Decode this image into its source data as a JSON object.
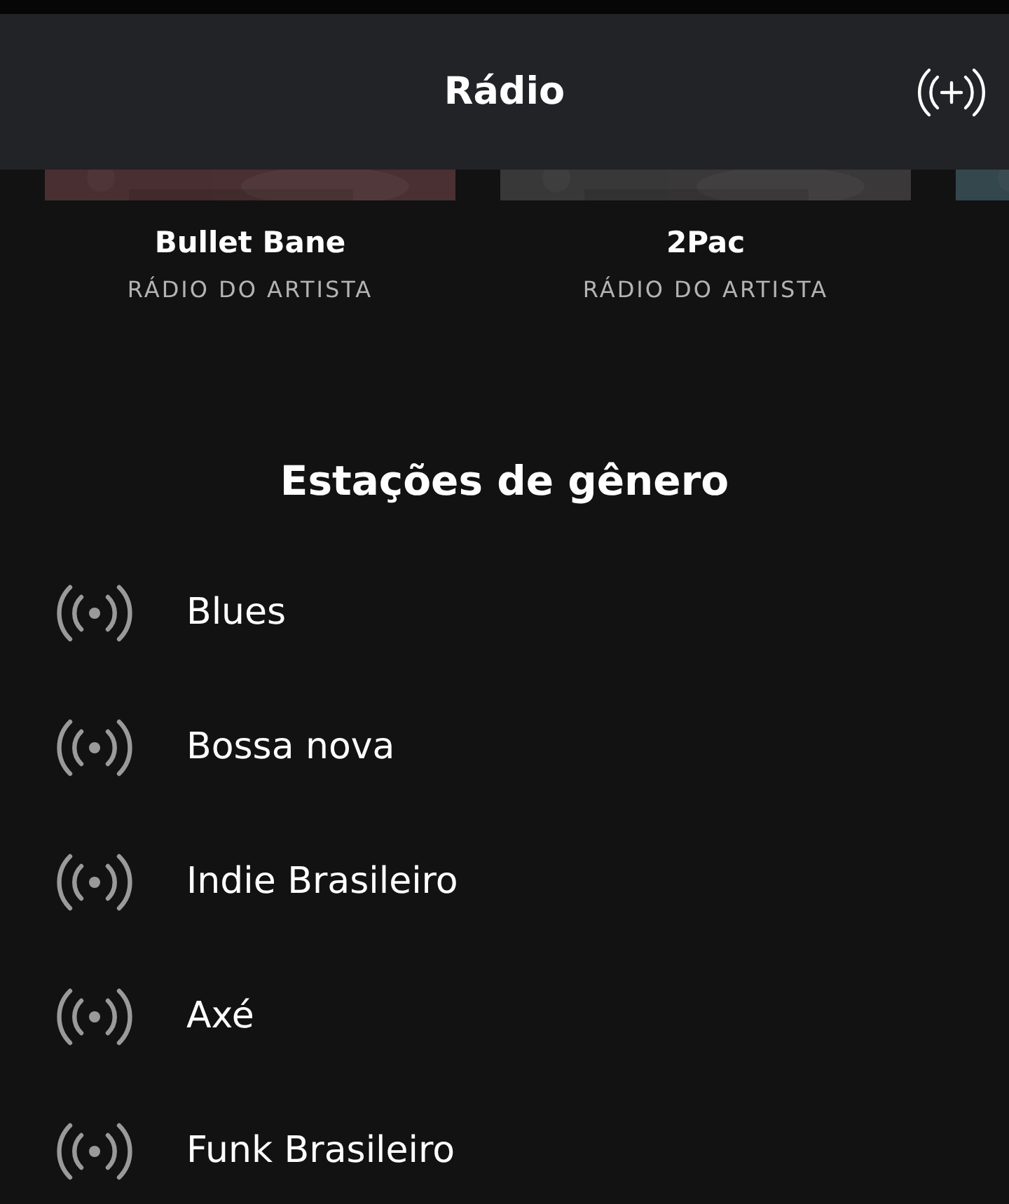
{
  "header": {
    "title": "Rádio"
  },
  "artist_cards": [
    {
      "artwork": {
        "kind": "picture"
      },
      "name": "Bullet Bane",
      "subtitle": "RÁDIO DO ARTISTA"
    },
    {
      "artwork": {
        "kind": "picture"
      },
      "name": "2Pac",
      "subtitle": "RÁDIO DO ARTISTA"
    },
    {
      "artwork": {
        "kind": "picture"
      }
    }
  ],
  "section": {
    "title": "Estações de gênero"
  },
  "stations": [
    {
      "name": "Blues"
    },
    {
      "name": "Bossa nova"
    },
    {
      "name": "Indie Brasileiro"
    },
    {
      "name": "Axé"
    },
    {
      "name": "Funk Brasileiro"
    }
  ]
}
